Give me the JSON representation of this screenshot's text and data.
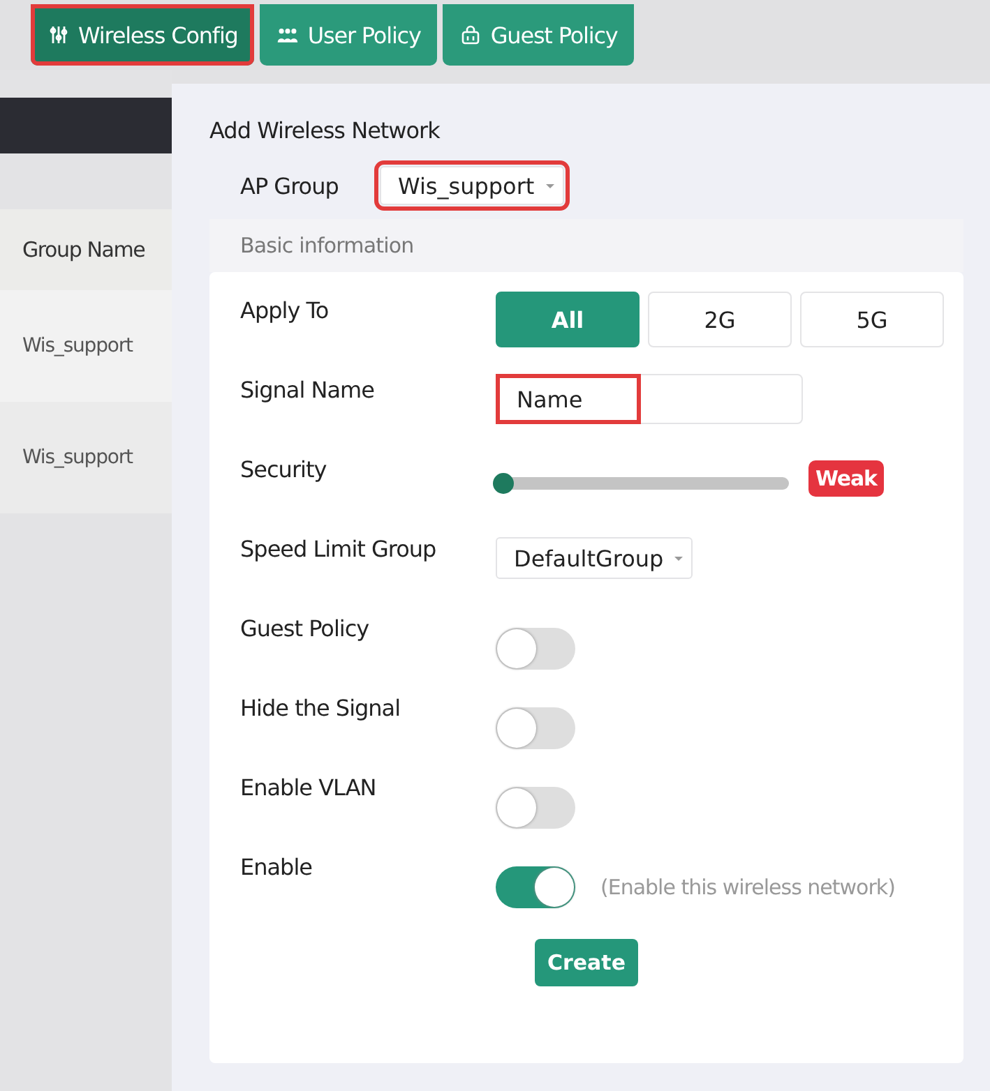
{
  "tabs": [
    {
      "label": "Wireless Config",
      "selected": true,
      "highlighted": true
    },
    {
      "label": "User Policy",
      "selected": false,
      "highlighted": false
    },
    {
      "label": "Guest Policy",
      "selected": false,
      "highlighted": false
    }
  ],
  "table": {
    "columns": [
      "Group Name"
    ],
    "rows": [
      [
        "Wis_support"
      ],
      [
        "Wis_support"
      ]
    ]
  },
  "dialog": {
    "title": "Add Wireless Network",
    "ap_group": {
      "label": "AP Group",
      "value": "Wis_support",
      "highlighted": true
    },
    "section": "Basic information",
    "fields": [
      {
        "kind": "segmented",
        "label": "Apply To",
        "options": [
          {
            "label": "All",
            "selected": true
          },
          {
            "label": "2G",
            "selected": false
          },
          {
            "label": "5G",
            "selected": false
          }
        ]
      },
      {
        "kind": "text",
        "label": "Signal Name",
        "value": "Name",
        "highlighted": true
      },
      {
        "kind": "slider",
        "label": "Security",
        "level": 0,
        "badge": "Weak",
        "color": "#e5343f"
      },
      {
        "kind": "select",
        "label": "Speed Limit Group",
        "value": "DefaultGroup"
      },
      {
        "kind": "toggle",
        "label": "Guest Policy",
        "on": false
      },
      {
        "kind": "toggle",
        "label": "Hide the Signal",
        "on": false
      },
      {
        "kind": "toggle",
        "label": "Enable VLAN",
        "on": false
      },
      {
        "kind": "toggle",
        "label": "Enable",
        "on": true,
        "hint": "(Enable this wireless network)"
      }
    ],
    "button": "Create"
  }
}
